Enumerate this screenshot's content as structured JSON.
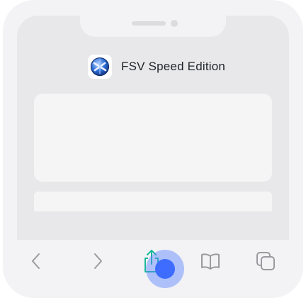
{
  "app": {
    "title": "FSV Speed Edition",
    "icon": "fsv-app-icon"
  },
  "toolbar": {
    "buttons": [
      {
        "icon": "back-chevron-icon"
      },
      {
        "icon": "forward-chevron-icon"
      },
      {
        "icon": "share-icon"
      },
      {
        "icon": "bookmarks-book-icon"
      },
      {
        "icon": "tabs-icon"
      }
    ]
  },
  "colors": {
    "accent": "#3d6cff",
    "share_icon": "#18b89a",
    "icon_gray": "#9a9aa0"
  }
}
